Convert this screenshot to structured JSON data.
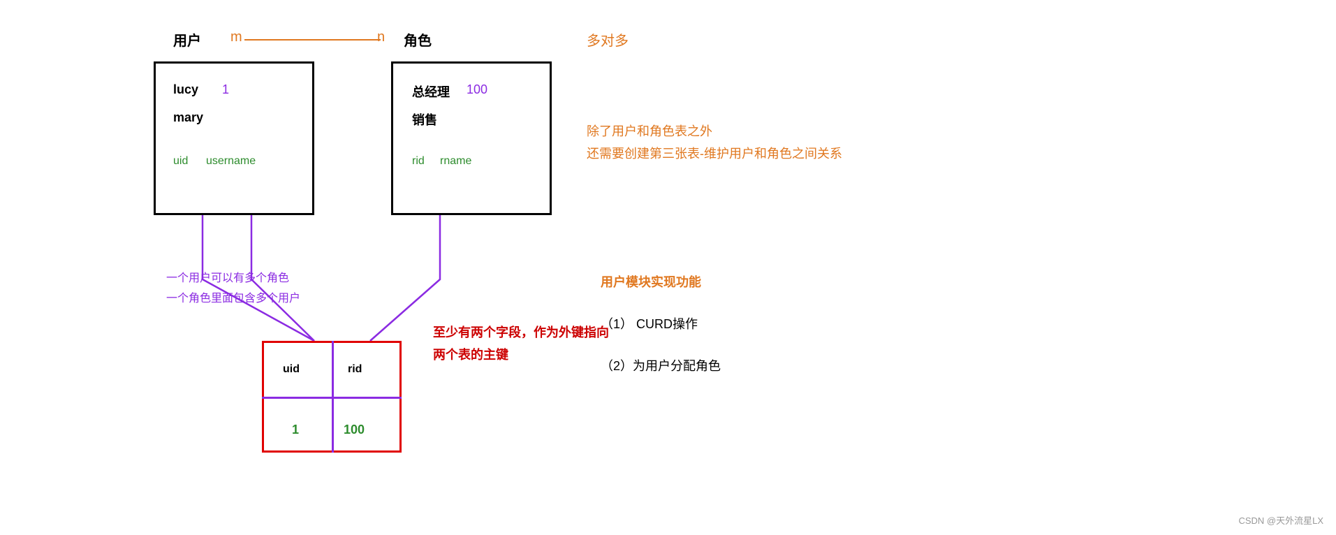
{
  "header": {
    "label_user": "用户",
    "label_m": "m",
    "label_n": "n",
    "label_role": "角色",
    "label_many_to_many": "多对多"
  },
  "user_table": {
    "row1_name": "lucy",
    "row1_num": "1",
    "row2_name": "mary",
    "col1": "uid",
    "col2": "username"
  },
  "role_table": {
    "row1_name": "总经理",
    "row1_num": "100",
    "row2_name": "销售",
    "col1": "rid",
    "col2": "rname"
  },
  "third_table": {
    "col1": "uid",
    "col2": "rid",
    "val1": "1",
    "val2": "100"
  },
  "notes": {
    "also": "除了用户和角色表之外",
    "also2": "还需要创建第三张表-维护用户和角色之间关系",
    "one_user_many_roles": "一个用户可以有多个角色",
    "one_role_many_users": "一个角色里面包含多个用户",
    "red_note_1": "至少有两个字段，作为外键指向",
    "red_note_2": "两个表的主键",
    "user_module": "用户模块实现功能",
    "curd": "（1）  CURD操作",
    "assign": "（2）为用户分配角色"
  },
  "watermark": "CSDN @天外流星LX"
}
